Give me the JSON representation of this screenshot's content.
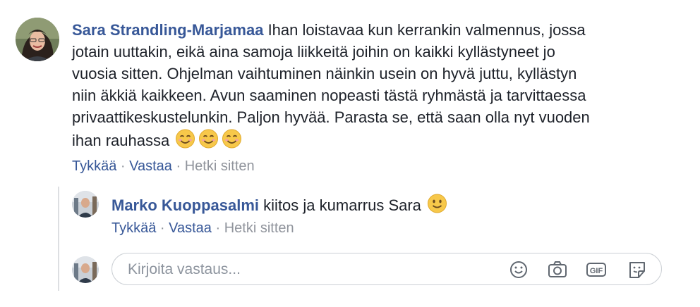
{
  "comment": {
    "author": "Sara Strandling-Marjamaa",
    "lines": [
      "Ihan loistavaa kun kerrankin valmennus, jossa",
      "jotain uuttakin, eikä aina samoja liikkeitä joihin on kaikki kyllästyneet jo",
      "vuosia sitten. Ohjelman vaihtuminen näinkin usein on hyvä juttu, kyllästyn",
      "niin äkkiä kaikkeen. Avun saaminen nopeasti tästä ryhmästä ja tarvittaessa",
      "privaattikeskustelunkin. Paljon hyvää. Parasta se, että saan olla nyt vuoden",
      "ihan rauhassa"
    ],
    "emojis": [
      "smiling-face-with-smiling-eyes",
      "smiling-face-with-smiling-eyes",
      "smiling-face-with-smiling-eyes"
    ],
    "actions": {
      "like": "Tykkää",
      "reply": "Vastaa",
      "time": "Hetki sitten"
    }
  },
  "reply": {
    "author": "Marko Kuoppasalmi",
    "text": "kiitos ja kumarrus Sara",
    "emoji": "slightly-smiling-face",
    "actions": {
      "like": "Tykkää",
      "reply": "Vastaa",
      "time": "Hetki sitten"
    }
  },
  "reply_box": {
    "placeholder": "Kirjoita vastaus...",
    "icons": [
      "emoji-icon",
      "camera-icon",
      "gif-icon",
      "sticker-icon"
    ]
  },
  "separator": " · "
}
